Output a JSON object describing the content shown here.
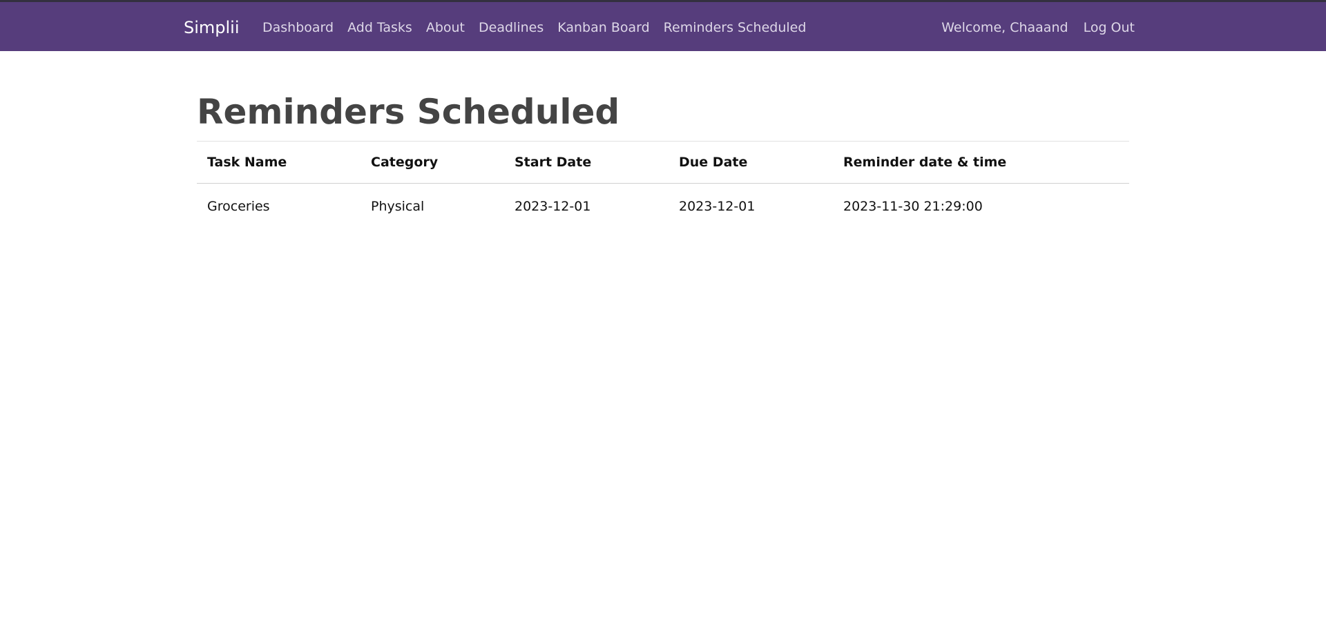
{
  "navbar": {
    "brand": "Simplii",
    "links": [
      "Dashboard",
      "Add Tasks",
      "About",
      "Deadlines",
      "Kanban Board",
      "Reminders Scheduled"
    ],
    "welcome": "Welcome, Chaaand",
    "logout": "Log Out"
  },
  "page": {
    "title": "Reminders Scheduled"
  },
  "table": {
    "headers": [
      "Task Name",
      "Category",
      "Start Date",
      "Due Date",
      "Reminder date & time"
    ],
    "rows": [
      [
        "Groceries",
        "Physical",
        "2023-12-01",
        "2023-12-01",
        "2023-11-30 21:29:00"
      ]
    ]
  },
  "colors": {
    "navbar_bg": "#563d7c",
    "title": "#444444"
  }
}
